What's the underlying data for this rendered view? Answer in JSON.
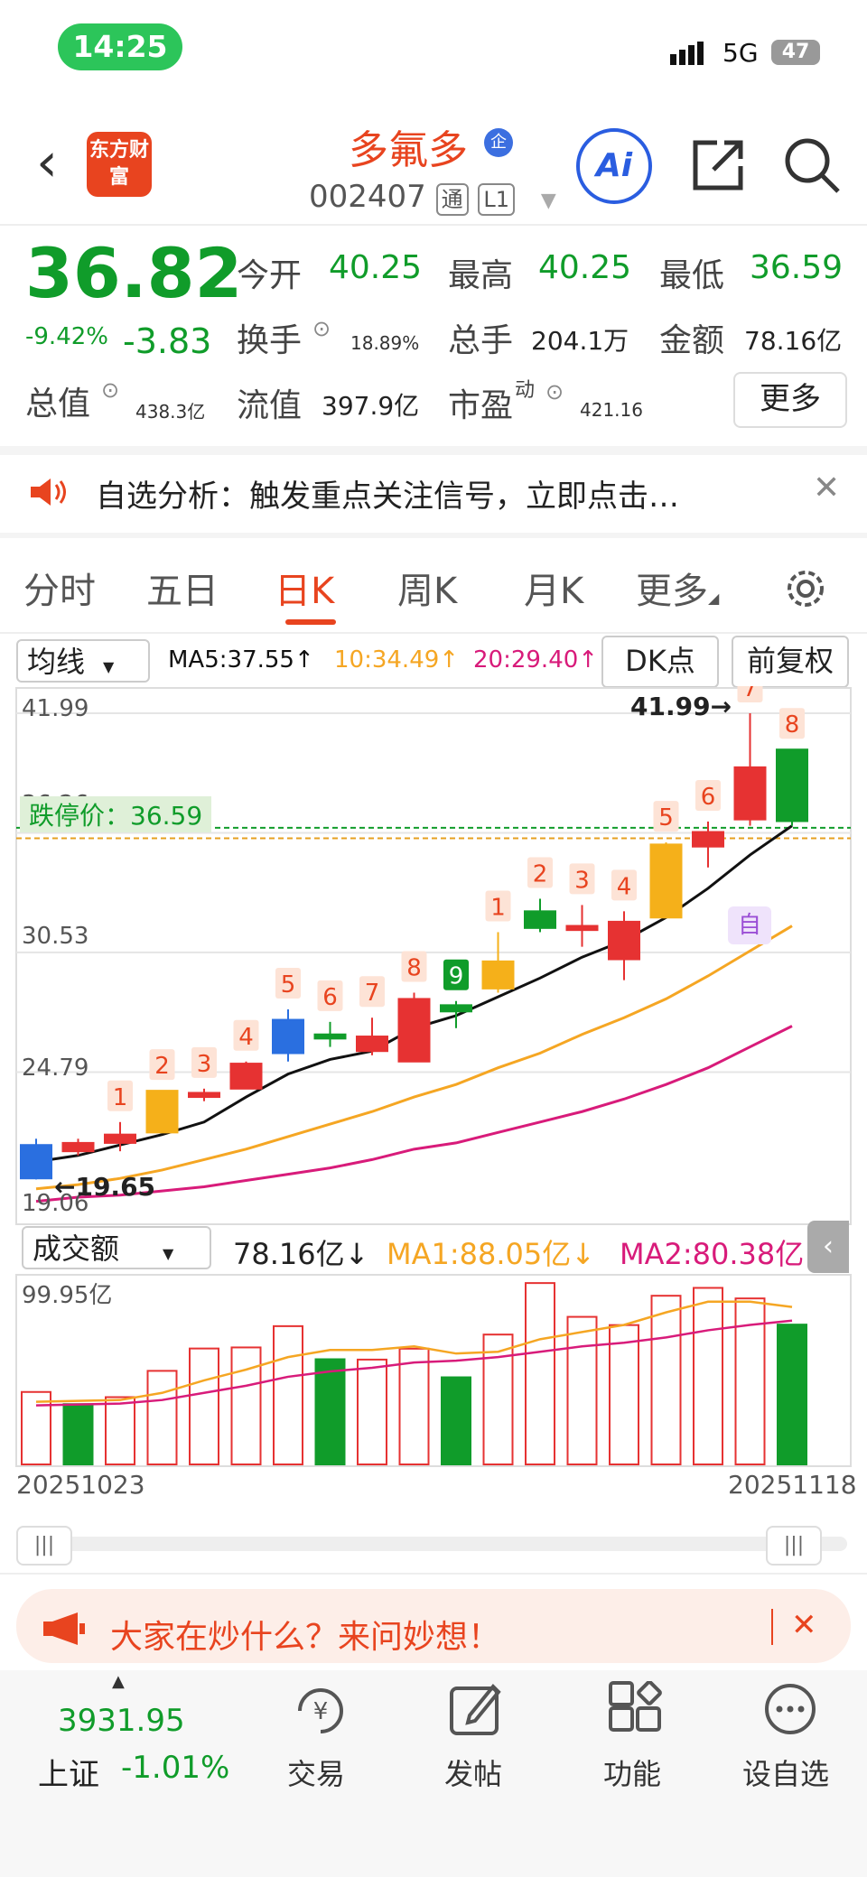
{
  "status": {
    "time": "14:25",
    "network": "5G",
    "battery": "47"
  },
  "header": {
    "logo": "东方财富",
    "name": "多氟多",
    "name_badge": "企",
    "code": "002407",
    "tag1": "通",
    "tag2": "L1"
  },
  "quote": {
    "price": "36.82",
    "pct": "-9.42%",
    "change": "-3.83",
    "open_label": "今开",
    "open": "40.25",
    "high_label": "最高",
    "high": "40.25",
    "low_label": "最低",
    "low": "36.59",
    "turnover_label": "换手",
    "turnover": "18.89%",
    "volume_label": "总手",
    "volume": "204.1万",
    "amount_label": "金额",
    "amount": "78.16亿",
    "mktcap_label": "总值",
    "mktcap": "438.3亿",
    "float_label": "流值",
    "float": "397.9亿",
    "pe_label": "市盈",
    "pe_sup": "动",
    "pe": "421.16",
    "more": "更多"
  },
  "alert": {
    "text": "自选分析：触发重点关注信号，立即点击…"
  },
  "tabs": [
    "分时",
    "五日",
    "日K",
    "周K",
    "月K",
    "更多"
  ],
  "chart_controls": {
    "ma_select": "均线",
    "ma5": "MA5:37.55↑",
    "ma10": "10:34.49↑",
    "ma20": "20:29.40↑",
    "dk": "DK点",
    "fq": "前复权"
  },
  "chart_labels": {
    "y_top": "41.99",
    "y2": "36.26",
    "y3": "30.53",
    "y4": "24.79",
    "y_bottom": "19.06",
    "limit_down": "跌停价：36.59",
    "high_mark": "41.99→",
    "low_mark": "←19.65",
    "self": "自"
  },
  "volume_controls": {
    "select": "成交额",
    "value": "78.16亿↓",
    "ma1": "MA1:88.05亿↓",
    "ma2": "MA2:80.38亿↓",
    "y_top": "99.95亿"
  },
  "dates": {
    "start": "20251023",
    "end": "20251118"
  },
  "promo": {
    "text": "大家在炒什么？来问妙想！"
  },
  "bottom_nav": {
    "index_value": "3931.95",
    "index_name": "上证",
    "index_pct": "-1.01%",
    "trade": "交易",
    "post": "发帖",
    "func": "功能",
    "watch": "设自选"
  },
  "colors": {
    "up": "#e63232",
    "down": "#109c2a",
    "brand": "#e8441f",
    "ma5": "#111111",
    "ma10": "#f5a623",
    "ma20": "#d81b7a"
  },
  "chart_data": {
    "type": "candlestick",
    "ylim": [
      19.06,
      41.99
    ],
    "candles": [
      {
        "o": 21.3,
        "c": 19.7,
        "h": 21.6,
        "l": 19.65,
        "color": "blue"
      },
      {
        "o": 21.0,
        "c": 21.4,
        "h": 21.6,
        "l": 20.8,
        "color": "up"
      },
      {
        "o": 21.4,
        "c": 21.8,
        "h": 22.4,
        "l": 21.0,
        "color": "up"
      },
      {
        "o": 21.9,
        "c": 23.9,
        "h": 23.9,
        "l": 21.9,
        "color": "orange"
      },
      {
        "o": 23.6,
        "c": 23.8,
        "h": 24.0,
        "l": 23.4,
        "color": "up"
      },
      {
        "o": 24.0,
        "c": 25.2,
        "h": 25.3,
        "l": 24.0,
        "color": "up"
      },
      {
        "o": 25.7,
        "c": 27.3,
        "h": 27.8,
        "l": 25.3,
        "color": "blue"
      },
      {
        "o": 26.6,
        "c": 26.4,
        "h": 27.2,
        "l": 26.0,
        "color": "down"
      },
      {
        "o": 25.8,
        "c": 26.5,
        "h": 27.4,
        "l": 25.6,
        "color": "up"
      },
      {
        "o": 25.3,
        "c": 28.3,
        "h": 28.6,
        "l": 25.3,
        "color": "up"
      },
      {
        "o": 27.7,
        "c": 28.0,
        "h": 28.2,
        "l": 26.9,
        "color": "down"
      },
      {
        "o": 28.8,
        "c": 30.1,
        "h": 31.5,
        "l": 28.6,
        "color": "orange"
      },
      {
        "o": 31.7,
        "c": 32.5,
        "h": 33.1,
        "l": 31.5,
        "color": "down"
      },
      {
        "o": 31.8,
        "c": 31.6,
        "h": 32.8,
        "l": 30.8,
        "color": "up"
      },
      {
        "o": 30.2,
        "c": 32.0,
        "h": 32.5,
        "l": 29.2,
        "color": "up"
      },
      {
        "o": 32.2,
        "c": 35.7,
        "h": 35.8,
        "l": 32.2,
        "color": "orange"
      },
      {
        "o": 35.6,
        "c": 36.3,
        "h": 36.8,
        "l": 34.6,
        "color": "up"
      },
      {
        "o": 36.9,
        "c": 39.4,
        "h": 41.99,
        "l": 36.6,
        "color": "up"
      },
      {
        "o": 40.25,
        "c": 36.82,
        "h": 40.25,
        "l": 36.59,
        "color": "down"
      }
    ],
    "ma5": [
      20.5,
      20.8,
      21.3,
      21.8,
      22.4,
      23.6,
      24.7,
      25.4,
      25.8,
      26.9,
      27.5,
      28.4,
      29.3,
      30.3,
      31.1,
      32.2,
      33.6,
      35.2,
      36.6
    ],
    "ma10": [
      19.2,
      19.4,
      19.7,
      20.1,
      20.6,
      21.1,
      21.7,
      22.3,
      22.9,
      23.6,
      24.2,
      25.0,
      25.7,
      26.6,
      27.4,
      28.3,
      29.4,
      30.6,
      31.8
    ],
    "ma20": [
      18.6,
      18.8,
      18.9,
      19.1,
      19.3,
      19.6,
      19.9,
      20.2,
      20.6,
      21.1,
      21.4,
      21.9,
      22.4,
      22.9,
      23.5,
      24.2,
      25.0,
      26.0,
      27.0
    ],
    "volume": [
      40.5,
      33.7,
      37.6,
      52.3,
      64.8,
      65.4,
      77.3,
      58.8,
      58.6,
      64.7,
      48.7,
      72.6,
      101.4,
      82.5,
      77.9,
      94.3,
      98.7,
      92.8,
      78.16
    ],
    "volume_color": [
      "up",
      "down",
      "up",
      "up",
      "up",
      "up",
      "up",
      "down",
      "up",
      "up",
      "down",
      "up",
      "up",
      "up",
      "up",
      "up",
      "up",
      "up",
      "down"
    ],
    "vol_ma1": [
      35.0,
      35.5,
      36.0,
      40.0,
      47.0,
      53.0,
      60.0,
      64.0,
      64.0,
      66.0,
      62.0,
      63.0,
      70.0,
      74.0,
      78.0,
      85.0,
      91.0,
      91.0,
      88.05
    ],
    "vol_ma2": [
      33.0,
      33.5,
      34.0,
      36.0,
      40.0,
      44.0,
      49.0,
      52.0,
      54.0,
      57.0,
      58.0,
      60.0,
      63.0,
      66.0,
      68.0,
      71.0,
      75.0,
      78.0,
      80.38
    ],
    "candle_tags": [
      "",
      "",
      "1",
      "2",
      "3",
      "4",
      "5",
      "6",
      "7",
      "8",
      "9",
      "1",
      "2",
      "3",
      "4",
      "5",
      "6",
      "7",
      "8"
    ],
    "vol_ylim": [
      0,
      99.95
    ]
  }
}
